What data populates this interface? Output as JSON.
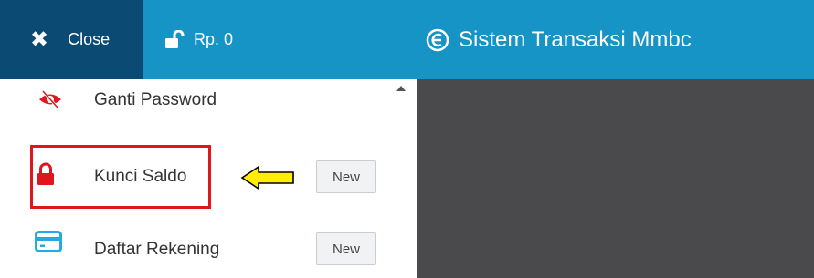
{
  "header": {
    "close_label": "Close",
    "saldo_text": "Rp. 0",
    "app_title": "Sistem Transaksi Mmbc"
  },
  "menu": {
    "items": [
      {
        "label": "Ganti Password",
        "icon": "eye-slash-icon"
      },
      {
        "label": "Kunci Saldo",
        "icon": "lock-icon",
        "badge": "New"
      },
      {
        "label": "Daftar Rekening",
        "icon": "credit-card-icon",
        "badge": "New"
      }
    ]
  },
  "colors": {
    "close_bg": "#0b4a73",
    "header_bg": "#1694c6",
    "content_bg": "#4a4a4c",
    "highlight": "#e0161d",
    "arrow_fill": "#ffee00",
    "lock_icon": "#e0161d",
    "card_icon": "#29a8e0",
    "eye_icon": "#e0161d"
  }
}
